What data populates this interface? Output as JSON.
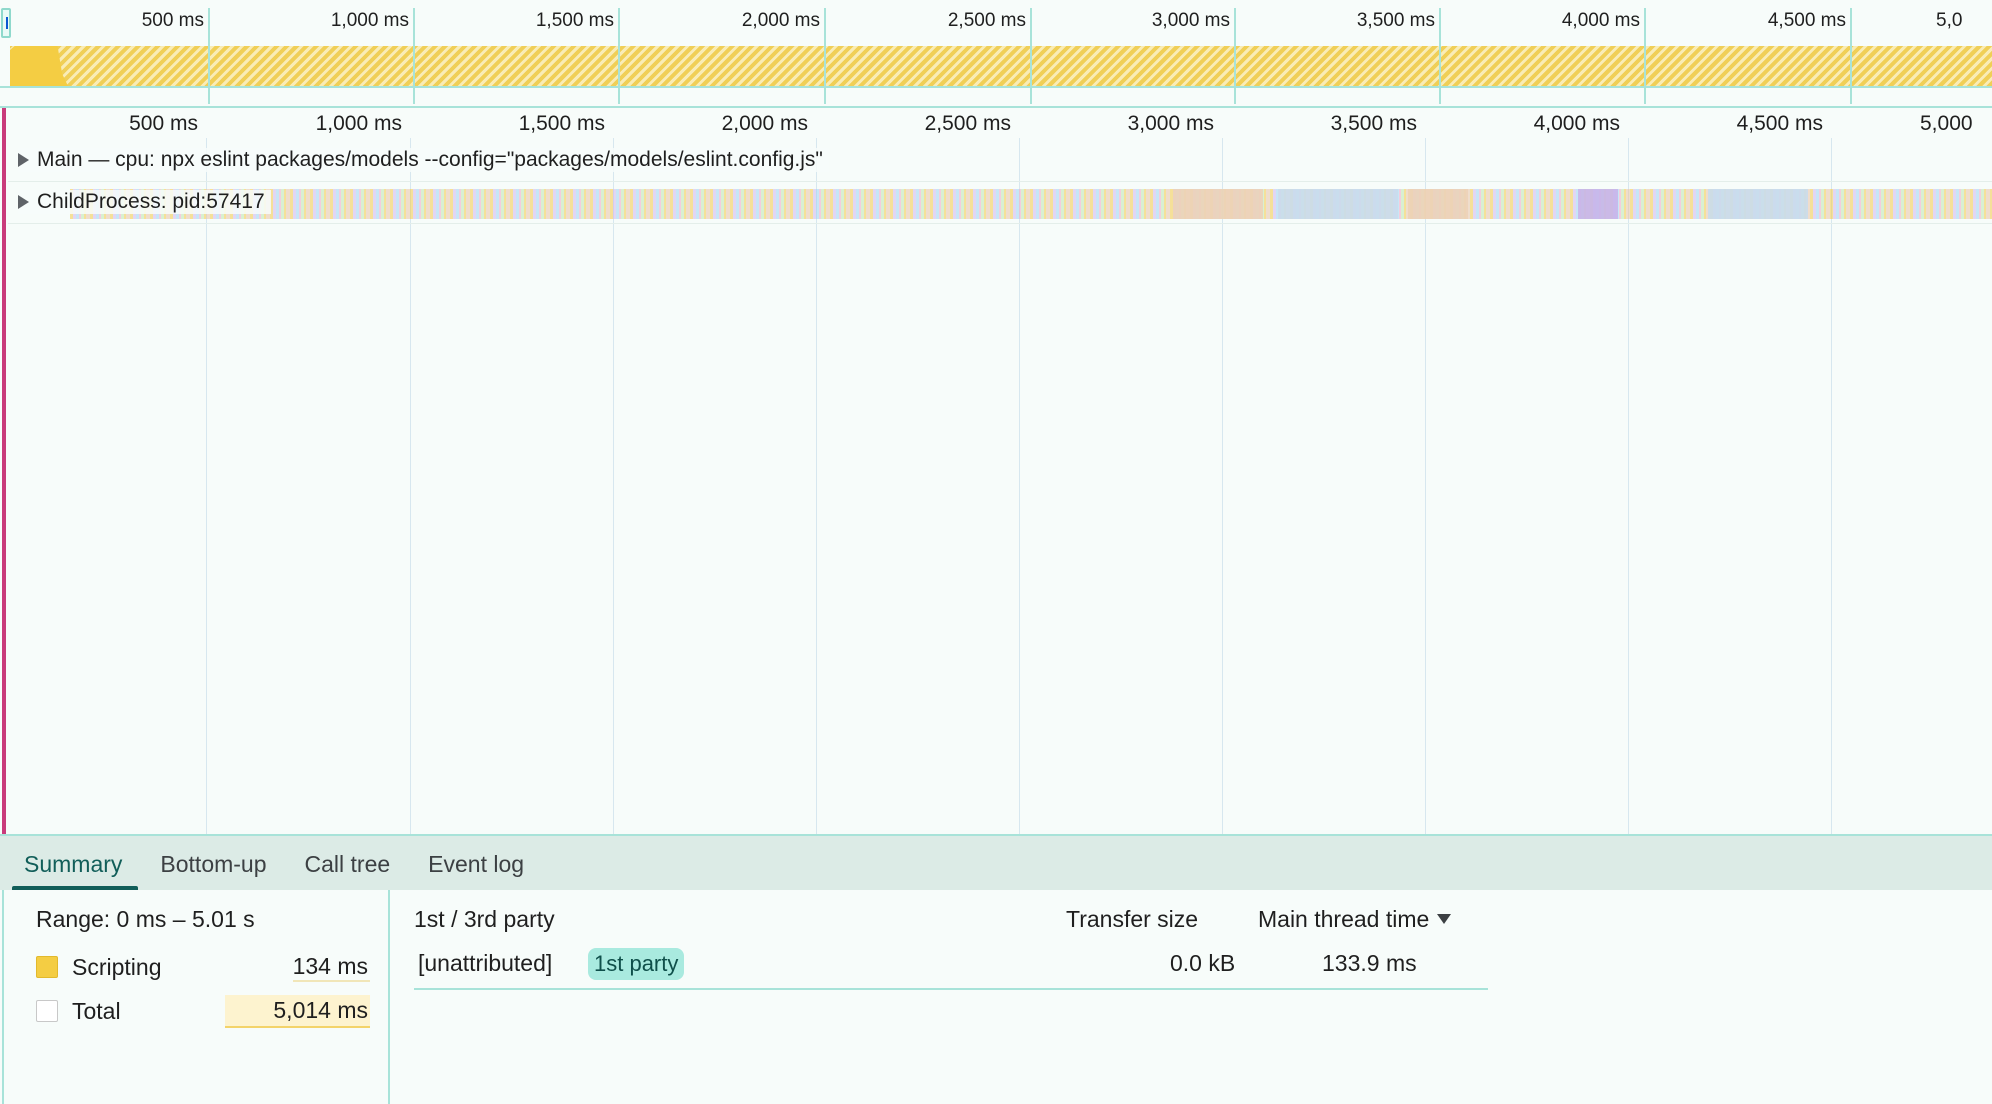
{
  "overview": {
    "ticks": [
      "500 ms",
      "1,000 ms",
      "1,500 ms",
      "2,000 ms",
      "2,500 ms",
      "3,000 ms",
      "3,500 ms",
      "4,000 ms",
      "4,500 ms",
      "5,0"
    ]
  },
  "timeline": {
    "ticks": [
      "500 ms",
      "1,000 ms",
      "1,500 ms",
      "2,000 ms",
      "2,500 ms",
      "3,000 ms",
      "3,500 ms",
      "4,000 ms",
      "4,500 ms",
      "5,000"
    ],
    "tracks": [
      {
        "label": "Main — cpu: npx eslint packages/models --config=\"packages/models/eslint.config.js\""
      },
      {
        "label": "ChildProcess: pid:57417"
      }
    ]
  },
  "tabs": [
    "Summary",
    "Bottom-up",
    "Call tree",
    "Event log"
  ],
  "summary": {
    "range": "Range: 0 ms – 5.01 s",
    "categories": [
      {
        "name": "Scripting",
        "value": "134 ms",
        "color": "#f4cd43"
      },
      {
        "name": "Total",
        "value": "5,014 ms",
        "color": "#f7fcfa"
      }
    ]
  },
  "party": {
    "headers": {
      "party": "1st / 3rd party",
      "transfer": "Transfer size",
      "main_thread": "Main thread time"
    },
    "rows": [
      {
        "name": "[unattributed]",
        "badge": "1st party",
        "transfer": "0.0 kB",
        "main_thread": "133.9 ms"
      }
    ]
  }
}
